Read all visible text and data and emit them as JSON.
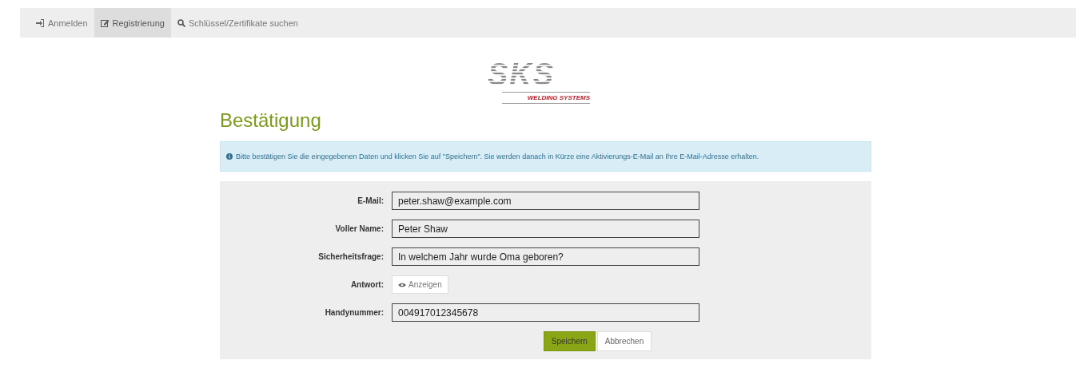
{
  "nav": {
    "items": [
      {
        "label": "Anmelden",
        "kind": "login",
        "selected": false
      },
      {
        "label": "Registrierung",
        "kind": "edit",
        "selected": true
      },
      {
        "label": "Schlüssel/Zertifikate suchen",
        "kind": "search",
        "selected": false
      }
    ]
  },
  "logo": {
    "mark": "SKS",
    "tagline": "WELDING SYSTEMS"
  },
  "heading": "Bestätigung",
  "alert": "Bitte bestätigen Sie die eingegebenen Daten und klicken Sie auf \"Speichern\". Sie werden danach in Kürze eine Aktivierungs-E-Mail an Ihre E-Mail-Adresse erhalten.",
  "form": {
    "fields": [
      {
        "kind": "text",
        "label": "E-Mail:",
        "value": "peter.shaw@example.com"
      },
      {
        "kind": "text",
        "label": "Voller Name:",
        "value": "Peter Shaw"
      },
      {
        "kind": "text",
        "label": "Sicherheitsfrage:",
        "value": "In welchem Jahr wurde Oma geboren?"
      },
      {
        "kind": "reveal",
        "label": "Antwort:",
        "button": "Anzeigen"
      },
      {
        "kind": "text",
        "label": "Handynummer:",
        "value": "004917012345678"
      }
    ],
    "buttons": [
      {
        "label": "Speichern",
        "kind": "primary"
      },
      {
        "label": "Abbrechen",
        "kind": "default"
      }
    ]
  }
}
